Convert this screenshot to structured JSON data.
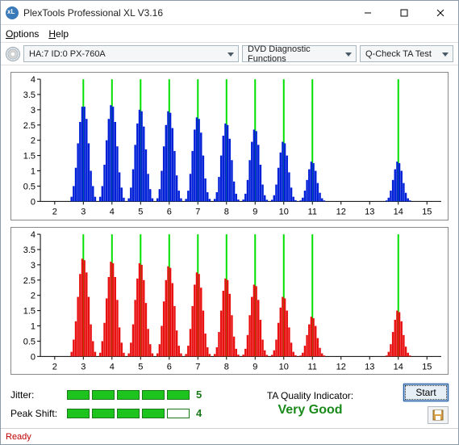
{
  "window": {
    "title": "PlexTools Professional XL V3.16"
  },
  "menu": {
    "options": "Options",
    "help": "Help"
  },
  "toolbar": {
    "drive_label": "HA:7 ID:0   PX-760A",
    "function_label": "DVD Diagnostic Functions",
    "test_label": "Q-Check TA Test"
  },
  "chart_data": [
    {
      "type": "bar",
      "color": "#0020d8",
      "xlim": [
        1.5,
        15.5
      ],
      "ylim": [
        0,
        4
      ],
      "yticks": [
        0,
        0.5,
        1,
        1.5,
        2,
        2.5,
        3,
        3.5,
        4
      ],
      "xticks": [
        2,
        3,
        4,
        5,
        6,
        7,
        8,
        9,
        10,
        11,
        12,
        13,
        14,
        15
      ],
      "markers": [
        3,
        4,
        5,
        6,
        7,
        8,
        9,
        10,
        11,
        14
      ],
      "series": [
        {
          "center": 3,
          "bars": [
            0.15,
            0.5,
            1.1,
            1.9,
            2.6,
            3.1,
            3.1,
            2.7,
            1.9,
            1.0,
            0.5,
            0.15
          ]
        },
        {
          "center": 4,
          "bars": [
            0.15,
            0.5,
            1.2,
            2.0,
            2.7,
            3.15,
            3.1,
            2.6,
            1.8,
            0.95,
            0.45,
            0.12
          ]
        },
        {
          "center": 5,
          "bars": [
            0.1,
            0.45,
            1.05,
            1.85,
            2.55,
            3.0,
            2.95,
            2.45,
            1.7,
            0.9,
            0.4,
            0.1
          ]
        },
        {
          "center": 6,
          "bars": [
            0.1,
            0.4,
            1.0,
            1.8,
            2.5,
            2.95,
            2.9,
            2.4,
            1.65,
            0.85,
            0.35,
            0.1
          ]
        },
        {
          "center": 7,
          "bars": [
            0.08,
            0.35,
            0.9,
            1.65,
            2.35,
            2.75,
            2.7,
            2.25,
            1.5,
            0.75,
            0.3,
            0.08
          ]
        },
        {
          "center": 8,
          "bars": [
            0.08,
            0.3,
            0.8,
            1.5,
            2.15,
            2.55,
            2.5,
            2.05,
            1.35,
            0.65,
            0.25,
            0.06
          ]
        },
        {
          "center": 9,
          "bars": [
            0.06,
            0.25,
            0.7,
            1.35,
            1.95,
            2.35,
            2.3,
            1.85,
            1.2,
            0.55,
            0.2,
            0.05
          ]
        },
        {
          "center": 10,
          "bars": [
            0.05,
            0.2,
            0.55,
            1.1,
            1.6,
            1.95,
            1.9,
            1.5,
            0.95,
            0.45,
            0.15,
            0.04
          ]
        },
        {
          "center": 11,
          "bars": [
            0.03,
            0.12,
            0.35,
            0.7,
            1.05,
            1.3,
            1.25,
            1.0,
            0.6,
            0.28,
            0.1,
            0.03
          ]
        },
        {
          "center": 14,
          "bars": [
            0.03,
            0.12,
            0.35,
            0.7,
            1.05,
            1.3,
            1.25,
            1.0,
            0.6,
            0.28,
            0.1,
            0.03
          ]
        }
      ]
    },
    {
      "type": "bar",
      "color": "#e81010",
      "xlim": [
        1.5,
        15.5
      ],
      "ylim": [
        0,
        4
      ],
      "yticks": [
        0,
        0.5,
        1,
        1.5,
        2,
        2.5,
        3,
        3.5,
        4
      ],
      "xticks": [
        2,
        3,
        4,
        5,
        6,
        7,
        8,
        9,
        10,
        11,
        12,
        13,
        14,
        15
      ],
      "markers": [
        3,
        4,
        5,
        6,
        7,
        8,
        9,
        10,
        11,
        14
      ],
      "series": [
        {
          "center": 3,
          "bars": [
            0.15,
            0.55,
            1.15,
            1.95,
            2.7,
            3.2,
            3.15,
            2.75,
            1.95,
            1.05,
            0.5,
            0.15
          ]
        },
        {
          "center": 4,
          "bars": [
            0.12,
            0.5,
            1.1,
            1.9,
            2.6,
            3.1,
            3.05,
            2.6,
            1.85,
            0.95,
            0.45,
            0.12
          ]
        },
        {
          "center": 5,
          "bars": [
            0.1,
            0.45,
            1.05,
            1.85,
            2.55,
            3.05,
            3.0,
            2.5,
            1.75,
            0.9,
            0.4,
            0.1
          ]
        },
        {
          "center": 6,
          "bars": [
            0.1,
            0.4,
            1.0,
            1.8,
            2.5,
            2.95,
            2.9,
            2.4,
            1.65,
            0.85,
            0.35,
            0.1
          ]
        },
        {
          "center": 7,
          "bars": [
            0.08,
            0.35,
            0.9,
            1.65,
            2.35,
            2.75,
            2.7,
            2.25,
            1.5,
            0.75,
            0.3,
            0.08
          ]
        },
        {
          "center": 8,
          "bars": [
            0.08,
            0.3,
            0.8,
            1.5,
            2.15,
            2.55,
            2.5,
            2.05,
            1.35,
            0.65,
            0.25,
            0.06
          ]
        },
        {
          "center": 9,
          "bars": [
            0.06,
            0.25,
            0.7,
            1.35,
            1.95,
            2.35,
            2.3,
            1.85,
            1.2,
            0.55,
            0.2,
            0.05
          ]
        },
        {
          "center": 10,
          "bars": [
            0.05,
            0.2,
            0.55,
            1.1,
            1.6,
            1.95,
            1.9,
            1.5,
            0.95,
            0.45,
            0.15,
            0.04
          ]
        },
        {
          "center": 11,
          "bars": [
            0.03,
            0.12,
            0.35,
            0.7,
            1.05,
            1.3,
            1.25,
            1.0,
            0.6,
            0.28,
            0.1,
            0.03
          ]
        },
        {
          "center": 14,
          "bars": [
            0.03,
            0.15,
            0.4,
            0.8,
            1.2,
            1.5,
            1.45,
            1.15,
            0.7,
            0.32,
            0.12,
            0.03
          ]
        }
      ]
    }
  ],
  "metrics": {
    "jitter_label": "Jitter:",
    "jitter_value": "5",
    "jitter_filled": 5,
    "peakshift_label": "Peak Shift:",
    "peakshift_value": "4",
    "peakshift_filled": 4
  },
  "taq": {
    "label": "TA Quality Indicator:",
    "value": "Very Good"
  },
  "actions": {
    "start": "Start"
  },
  "status": {
    "text": "Ready"
  }
}
